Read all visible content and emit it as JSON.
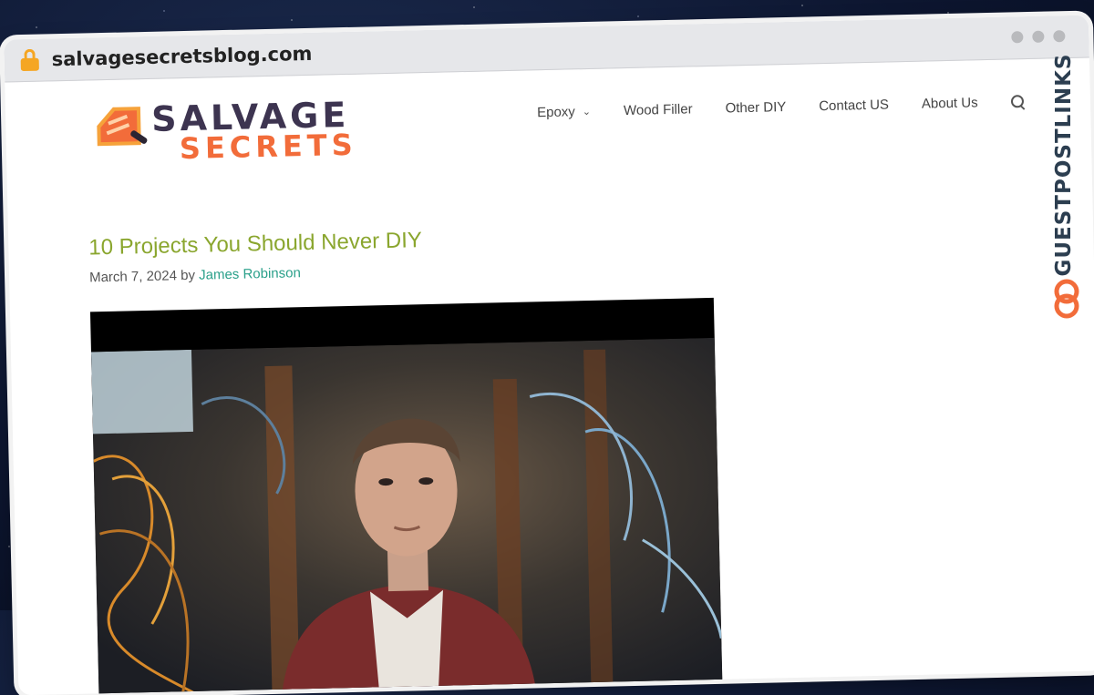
{
  "browser": {
    "url": "salvagesecretsblog.com",
    "lock_icon": "lock-icon",
    "window_dots": [
      "dot-1",
      "dot-2",
      "dot-3"
    ]
  },
  "site": {
    "logo": {
      "line1": "SALVAGE",
      "line2": "SECRETS"
    },
    "nav": [
      {
        "label": "Epoxy",
        "has_dropdown": true
      },
      {
        "label": "Wood Filler",
        "has_dropdown": false
      },
      {
        "label": "Other DIY",
        "has_dropdown": false
      },
      {
        "label": "Contact US",
        "has_dropdown": false
      },
      {
        "label": "About Us",
        "has_dropdown": false
      }
    ],
    "search_icon": "search-icon"
  },
  "article": {
    "title": "10 Projects You Should Never DIY",
    "date": "March 7, 2024",
    "by": "by",
    "author": "James Robinson",
    "image_alt_icon": "featured-image"
  },
  "watermark": {
    "text": "GUESTPOSTLINKS",
    "icon": "link-icon"
  },
  "colors": {
    "title": "#8aa62e",
    "author": "#2aa08a",
    "logo_dark": "#3d3450",
    "logo_orange": "#f26c3a",
    "lock": "#f5a623"
  }
}
